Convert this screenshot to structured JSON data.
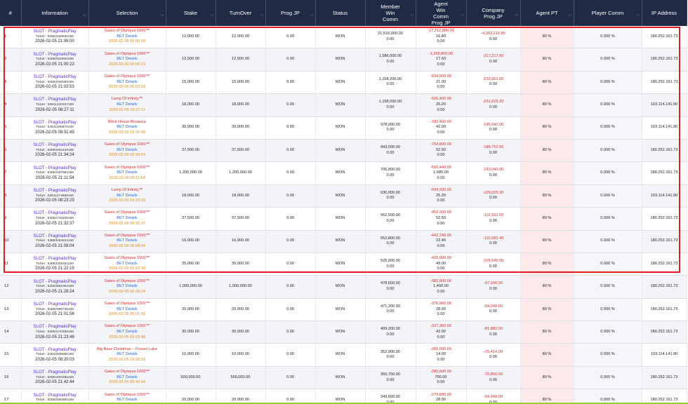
{
  "headers": [
    "#",
    "Information",
    "Selection",
    "Stake",
    "TurnOver",
    "Prog JP",
    "Status",
    "Member\nWin\nComm",
    "Agent\nWin\nComm\nProg JP",
    "Company\nProg JP",
    "Agent PT",
    "Player Comm",
    "IP Address"
  ],
  "sort_icon": "↑↓",
  "rows": [
    {
      "n": "1",
      "provider": "SLOT - PragmaticPlay",
      "ticket": "Ticket : 63853106830169",
      "date": "2026-02-05 21:06:00",
      "game": "Gates of Olympus 1000™",
      "bet": "BET Details",
      "sel_date": "2026-02-06 05:06:00",
      "stake": "12,000.00",
      "turnover": "12,000.00",
      "progjp": "0.00",
      "status": "WON",
      "member_win": "21,516,000.00",
      "member_comm": "0.00",
      "agent_win": "-17,212,800.00",
      "agent_comm": "16.80",
      "agent_jp": "0.00",
      "company_jp": "-4,303,216.80",
      "company_jp2": "0.00",
      "agent_pt": "80 %",
      "player_comm": "0.000 %",
      "ip": "180.252.161.73"
    },
    {
      "n": "2",
      "provider": "SLOT - PragmaticPlay",
      "ticket": "Ticket : 63852943652269",
      "date": "2026-02-05 21:00:23",
      "game": "Gates of Olympus 1000™",
      "bet": "BET Details",
      "sel_date": "2026-02-06 05:00:23",
      "stake": "12,500.00",
      "turnover": "12,500.00",
      "progjp": "0.00",
      "status": "WON",
      "member_win": "1,586,000.00",
      "member_comm": "0.00",
      "agent_win": "-1,268,800.00",
      "agent_comm": "17.50",
      "agent_jp": "0.00",
      "company_jp": "-317,217.50",
      "company_jp2": "0.00",
      "agent_pt": "80 %",
      "player_comm": "0.000 %",
      "ip": "180.252.161.73"
    },
    {
      "n": "3",
      "provider": "SLOT - PragmaticPlay",
      "ticket": "Ticket : 63853046083169",
      "date": "2026-02-05 21:03:53",
      "game": "Gates of Olympus 1000™",
      "bet": "BET Details",
      "sel_date": "2026-02-06 05:03:53",
      "stake": "15,000.00",
      "turnover": "15,000.00",
      "progjp": "0.00",
      "status": "WON",
      "member_win": "1,168,200.00",
      "member_comm": "0.00",
      "agent_win": "-934,560.00",
      "agent_comm": "21.00",
      "agent_jp": "0.00",
      "company_jp": "-233,661.00",
      "company_jp2": "0.00",
      "agent_pt": "80 %",
      "player_comm": "0.000 %",
      "ip": "180.252.161.73"
    },
    {
      "n": "4",
      "provider": "SLOT - PragmaticPlay",
      "ticket": "Ticket : 63811220157169",
      "date": "2026-02-05 08:27:11",
      "game": "Lamp Of Infinity™",
      "bet": "BET Details",
      "sel_date": "2026-02-05 16:27:11",
      "stake": "18,000.00",
      "turnover": "18,000.00",
      "progjp": "0.00",
      "status": "WON",
      "member_win": "1,158,000.00",
      "member_comm": "0.00",
      "agent_win": "-926,400.00",
      "agent_comm": "25.20",
      "agent_jp": "0.00",
      "company_jp": "-231,625.20",
      "company_jp2": "0.00",
      "agent_pt": "80 %",
      "player_comm": "0.000 %",
      "ip": "103.114.141.90"
    },
    {
      "n": "5",
      "provider": "SLOT - PragmaticPlay",
      "ticket": "Ticket : 63811400670169",
      "date": "2026-02-05 08:31:45",
      "game": "Brick House Bonanza",
      "bet": "BET Details",
      "sel_date": "2026-02-05 16:31:45",
      "stake": "30,000.00",
      "turnover": "30,000.00",
      "progjp": "0.00",
      "status": "WON",
      "member_win": "978,000.00",
      "member_comm": "0.00",
      "agent_win": "-782,400.00",
      "agent_comm": "42.00",
      "agent_jp": "0.00",
      "company_jp": "-195,642.00",
      "company_jp2": "0.00",
      "agent_pt": "80 %",
      "player_comm": "0.000 %",
      "ip": "103.114.141.90"
    },
    {
      "n": "6",
      "provider": "SLOT - PragmaticPlay",
      "ticket": "Ticket : 63853262433169",
      "date": "2026-02-05 21:34:24",
      "game": "Gates of Olympus 1000™",
      "bet": "BET Details",
      "sel_date": "2026-02-06 05:34:24",
      "stake": "37,500.00",
      "turnover": "37,500.00",
      "progjp": "0.00",
      "status": "WON",
      "member_win": "943,500.00",
      "member_comm": "0.00",
      "agent_win": "-754,800.00",
      "agent_comm": "52.50",
      "agent_jp": "0.00",
      "company_jp": "-188,752.50",
      "company_jp2": "0.00",
      "agent_pt": "80 %",
      "player_comm": "0.000 %",
      "ip": "180.252.161.73"
    },
    {
      "n": "7",
      "provider": "SLOT - PragmaticPlay",
      "ticket": "Ticket : 63853267884169",
      "date": "2026-02-05 21:11:54",
      "game": "Gates of Olympus 1000™",
      "bet": "BET Details",
      "sel_date": "2026-02-06 05:11:54",
      "stake": "1,200,000.00",
      "turnover": "1,200,000.00",
      "progjp": "0.00",
      "status": "WON",
      "member_win": "706,800.00",
      "member_comm": "0.00",
      "agent_win": "-565,440.00",
      "agent_comm": "1,680.00",
      "agent_jp": "0.00",
      "company_jp": "-143,040.00",
      "company_jp2": "0.00",
      "agent_pt": "80 %",
      "player_comm": "0.000 %",
      "ip": "180.252.161.73"
    },
    {
      "n": "8",
      "provider": "SLOT - PragmaticPlay",
      "ticket": "Ticket : 63811074696169",
      "date": "2026-02-05 08:23:29",
      "game": "Lamp Of Infinity™",
      "bet": "BET Details",
      "sel_date": "2026-02-05 16:23:29",
      "stake": "18,000.00",
      "turnover": "18,000.00",
      "progjp": "0.00",
      "status": "WON",
      "member_win": "630,000.00",
      "member_comm": "0.00",
      "agent_win": "-504,000.00",
      "agent_comm": "25.20",
      "agent_jp": "0.00",
      "company_jp": "-126,025.20",
      "company_jp2": "0.00",
      "agent_pt": "80 %",
      "player_comm": "0.000 %",
      "ip": "103.114.141.90"
    },
    {
      "n": "9",
      "provider": "SLOT - PragmaticPlay",
      "ticket": "Ticket : 63853718226169",
      "date": "2026-02-05 21:32:37",
      "game": "Gates of Olympus 1000™",
      "bet": "BET Details",
      "sel_date": "2026-02-06 05:32:37",
      "stake": "37,500.00",
      "turnover": "37,500.00",
      "progjp": "0.00",
      "status": "WON",
      "member_win": "562,500.00",
      "member_comm": "0.00",
      "agent_win": "-450,000.00",
      "agent_comm": "52.50",
      "agent_jp": "0.00",
      "company_jp": "-112,552.50",
      "company_jp2": "0.00",
      "agent_pt": "80 %",
      "player_comm": "0.000 %",
      "ip": "180.252.161.73"
    },
    {
      "n": "10",
      "provider": "SLOT - PragmaticPlay",
      "ticket": "Ticket : 63853164531169",
      "date": "2026-02-05 21:08:04",
      "game": "Gates of Olympus 1000™",
      "bet": "BET Details",
      "sel_date": "2026-02-06 05:08:04",
      "stake": "16,000.00",
      "turnover": "16,000.00",
      "progjp": "0.00",
      "status": "WON",
      "member_win": "552,800.00",
      "member_comm": "0.00",
      "agent_win": "-442,240.00",
      "agent_comm": "22.40",
      "agent_jp": "0.00",
      "company_jp": "-110,582.40",
      "company_jp2": "0.00",
      "agent_pt": "80 %",
      "player_comm": "0.000 %",
      "ip": "180.252.161.73"
    },
    {
      "n": "11",
      "provider": "SLOT - PragmaticPlay",
      "ticket": "Ticket : 63853325491169",
      "date": "2026-02-05 21:22:19",
      "game": "Gates of Olympus 1000™",
      "bet": "BET Details",
      "sel_date": "2026-02-06 05:22:19",
      "stake": "35,000.00",
      "turnover": "35,000.00",
      "progjp": "0.00",
      "status": "WON",
      "member_win": "525,000.00",
      "member_comm": "0.00",
      "agent_win": "-420,000.00",
      "agent_comm": "49.00",
      "agent_jp": "0.00",
      "company_jp": "-105,049.00",
      "company_jp2": "0.00",
      "agent_pt": "80 %",
      "player_comm": "0.000 %",
      "ip": "180.252.161.73"
    },
    {
      "n": "12",
      "provider": "SLOT - PragmaticPlay",
      "ticket": "Ticket : 63853681954169",
      "date": "2026-02-05 21:28:24",
      "game": "Gates of Olympus 1000™",
      "bet": "BET Details",
      "sel_date": "2026-02-06 05:28:24",
      "stake": "1,000,000.00",
      "turnover": "1,000,000.00",
      "progjp": "0.00",
      "status": "WON",
      "member_win": "478,500.00",
      "member_comm": "0.00",
      "agent_win": "-382,800.00",
      "agent_comm": "1,400.00",
      "agent_jp": "0.00",
      "company_jp": "-97,100.00",
      "company_jp2": "0.00",
      "agent_pt": "80 %",
      "player_comm": "0.000 %",
      "ip": "180.252.161.73"
    },
    {
      "n": "13",
      "provider": "SLOT - PragmaticPlay",
      "ticket": "Ticket : 63852989738169",
      "date": "2026-02-05 21:01:56",
      "game": "Gates of Olympus 1000™",
      "bet": "BET Details",
      "sel_date": "2026-02-06 05:01:56",
      "stake": "20,000.00",
      "turnover": "20,000.00",
      "progjp": "0.00",
      "status": "WON",
      "member_win": "471,200.00",
      "member_comm": "0.00",
      "agent_win": "-376,960.00",
      "agent_comm": "28.00",
      "agent_jp": "0.00",
      "company_jp": "-94,268.00",
      "company_jp2": "0.00",
      "agent_pt": "80 %",
      "player_comm": "0.000 %",
      "ip": "180.252.161.73"
    },
    {
      "n": "14",
      "provider": "SLOT - PragmaticPlay",
      "ticket": "Ticket : 63853170459169",
      "date": "2026-02-05 21:23:48",
      "game": "Gates of Olympus 1000™",
      "bet": "BET Details",
      "sel_date": "2026-02-06 05:23:48",
      "stake": "30,000.00",
      "turnover": "30,000.00",
      "progjp": "0.00",
      "status": "WON",
      "member_win": "409,200.00",
      "member_comm": "0.00",
      "agent_win": "-327,360.00",
      "agent_comm": "42.00",
      "agent_jp": "0.00",
      "company_jp": "-81,882.00",
      "company_jp2": "0.00",
      "agent_pt": "80 %",
      "player_comm": "0.000 %",
      "ip": "180.252.161.73"
    },
    {
      "n": "15",
      "provider": "SLOT - PragmaticPlay",
      "ticket": "Ticket : 63810938855169",
      "date": "2026-02-05 08:20:03",
      "game": "Big Bass Christmas – Frozen Lake",
      "bet": "BET Details",
      "sel_date": "2026-02-05 16:20:03",
      "stake": "10,000.00",
      "turnover": "10,000.00",
      "progjp": "0.00",
      "status": "WON",
      "member_win": "352,000.00",
      "member_comm": "0.00",
      "agent_win": "-281,600.00",
      "agent_comm": "14.00",
      "agent_jp": "0.00",
      "company_jp": "-70,414.00",
      "company_jp2": "0.00",
      "agent_pt": "80 %",
      "player_comm": "0.000 %",
      "ip": "103.114.141.90"
    },
    {
      "n": "16",
      "provider": "SLOT - PragmaticPlay",
      "ticket": "Ticket : 63854403486169",
      "date": "2026-02-05 21:42:44",
      "game": "Gates of Olympus 1000™",
      "bet": "BET Details",
      "sel_date": "2026-02-06 05:42:44",
      "stake": "500,000.00",
      "turnover": "500,000.00",
      "progjp": "0.00",
      "status": "WON",
      "member_win": "350,750.00",
      "member_comm": "0.00",
      "agent_win": "-280,600.00",
      "agent_comm": "700.00",
      "agent_jp": "0.00",
      "company_jp": "-70,850.00",
      "company_jp2": "0.00",
      "agent_pt": "80 %",
      "player_comm": "0.000 %",
      "ip": "180.252.161.73"
    },
    {
      "n": "17",
      "provider": "SLOT - PragmaticPlay",
      "ticket": "Ticket : 63853480650169",
      "date": "2026-02-05 21:33:50",
      "game": "Gates of Olympus 1000™",
      "bet": "BET Details",
      "sel_date": "2026-02-06 05:33:50",
      "stake": "20,000.00",
      "turnover": "20,000.00",
      "progjp": "0.00",
      "status": "WON",
      "member_win": "349,600.00",
      "member_comm": "0.00",
      "agent_win": "-279,680.00",
      "agent_comm": "28.00",
      "agent_jp": "0.00",
      "company_jp": "-69,948.00",
      "company_jp2": "0.00",
      "agent_pt": "80 %",
      "player_comm": "0.000 %",
      "ip": "180.252.161.73"
    }
  ]
}
